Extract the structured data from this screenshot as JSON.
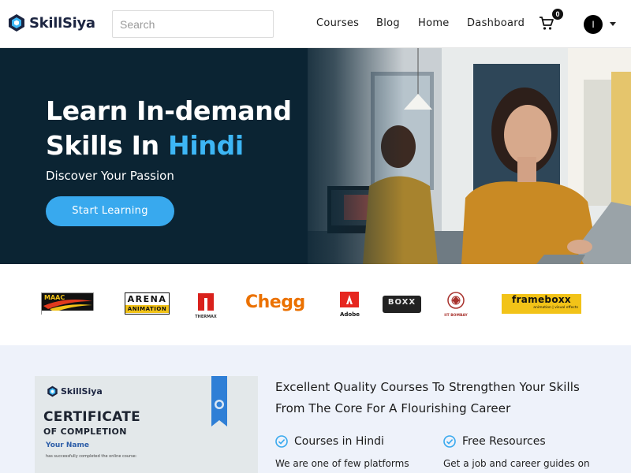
{
  "header": {
    "brand": "SkillSiya",
    "search_placeholder": "Search",
    "nav": [
      "Courses",
      "Blog",
      "Home",
      "Dashboard"
    ],
    "cart_count": "0",
    "avatar_initial": "I"
  },
  "hero": {
    "title_line1": "Learn In-demand",
    "title_line2_prefix": "Skills In ",
    "title_accent": "Hindi",
    "subtitle": "Discover Your Passion",
    "cta": "Start Learning"
  },
  "partners": {
    "maac": "MAAC",
    "arena_top": "ARENA",
    "arena_bottom": "ANIMATION",
    "thermax": "THERMAX",
    "chegg": "Chegg",
    "adobe": "Adobe",
    "boxx": "BOXX",
    "iit": "IIT BOMBAY",
    "frameboxx": "frameboxx",
    "frameboxx_sub": "animation | visual effects"
  },
  "certificate": {
    "brand": "SkillSiya",
    "title": "CERTIFICATE",
    "subtitle": "OF COMPLETION",
    "name": "Your Name",
    "line": "has successfully completed the online course:"
  },
  "features": {
    "heading": "Excellent Quality Courses To Strengthen Your Skills From The Core For A Flourishing Career",
    "items": [
      {
        "title": "Courses in Hindi",
        "desc": "We are one of few platforms"
      },
      {
        "title": "Free Resources",
        "desc": "Get a job and career guides on"
      }
    ]
  },
  "colors": {
    "accent": "#3db6f5",
    "button": "#38a9ee",
    "hero_bg": "#0b2433",
    "features_bg": "#eef2fa"
  }
}
